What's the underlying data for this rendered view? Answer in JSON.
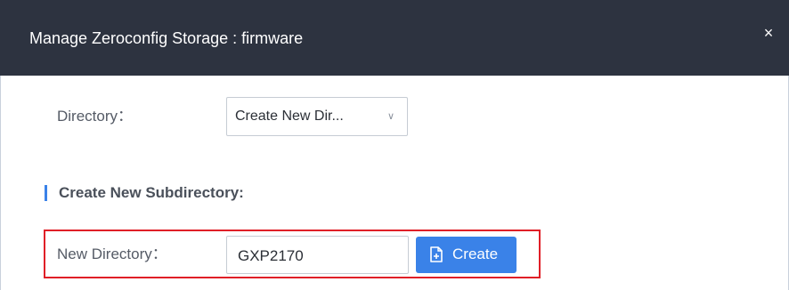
{
  "dialog": {
    "title": "Manage Zeroconfig Storage : firmware",
    "close_symbol": "×"
  },
  "directory": {
    "label": "Directory：",
    "selected_value": "Create New Dir...",
    "chevron_symbol": "∨"
  },
  "section": {
    "title": "Create New Subdirectory:"
  },
  "new_directory": {
    "label": "New Directory：",
    "value": "GXP2170"
  },
  "create_button": {
    "label": "Create",
    "icon": "file-add-icon"
  },
  "colors": {
    "header_bg": "#2d3340",
    "accent": "#3a82e8",
    "highlight": "#e01f27"
  }
}
